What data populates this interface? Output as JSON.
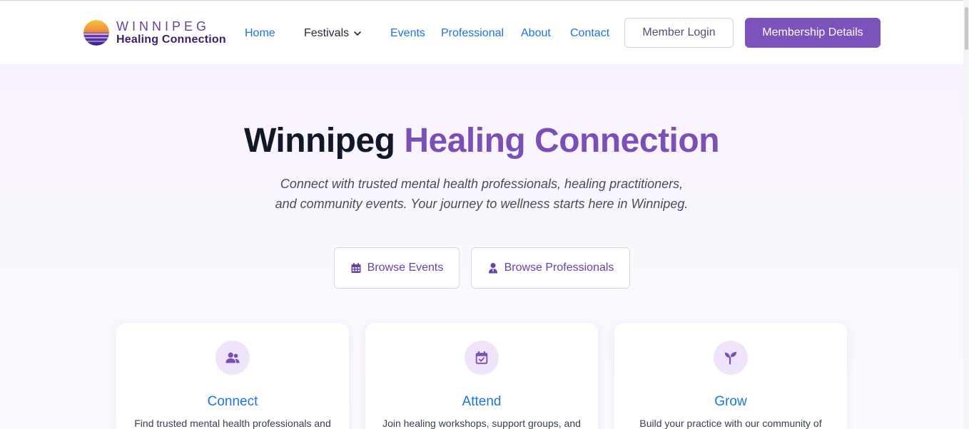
{
  "header": {
    "logo": {
      "line1": "WINNIPEG",
      "line2": "Healing Connection"
    },
    "nav": {
      "home": "Home",
      "festivals": "Festivals",
      "events": "Events",
      "professional": "Professional",
      "about": "About",
      "contact": "Contact"
    },
    "login_label": "Member Login",
    "membership_label": "Membership Details"
  },
  "hero": {
    "title_part1": "Winnipeg",
    "title_part2": "Healing Connection",
    "subtitle_line1": "Connect with trusted mental health professionals, healing practitioners,",
    "subtitle_line2": "and community events. Your journey to wellness starts here in Winnipeg.",
    "browse_events_label": "Browse Events",
    "browse_professionals_label": "Browse Professionals"
  },
  "cards": [
    {
      "icon": "users-icon",
      "title": "Connect",
      "text": "Find trusted mental health professionals and"
    },
    {
      "icon": "calendar-check-icon",
      "title": "Attend",
      "text": "Join healing workshops, support groups, and"
    },
    {
      "icon": "seedling-icon",
      "title": "Grow",
      "text": "Build your practice with our community of"
    }
  ],
  "colors": {
    "brand_purple": "#7b4fb6",
    "link_blue": "#1a73e8",
    "member_button": "#7c52bd",
    "icon_bg": "#efe4fa"
  }
}
